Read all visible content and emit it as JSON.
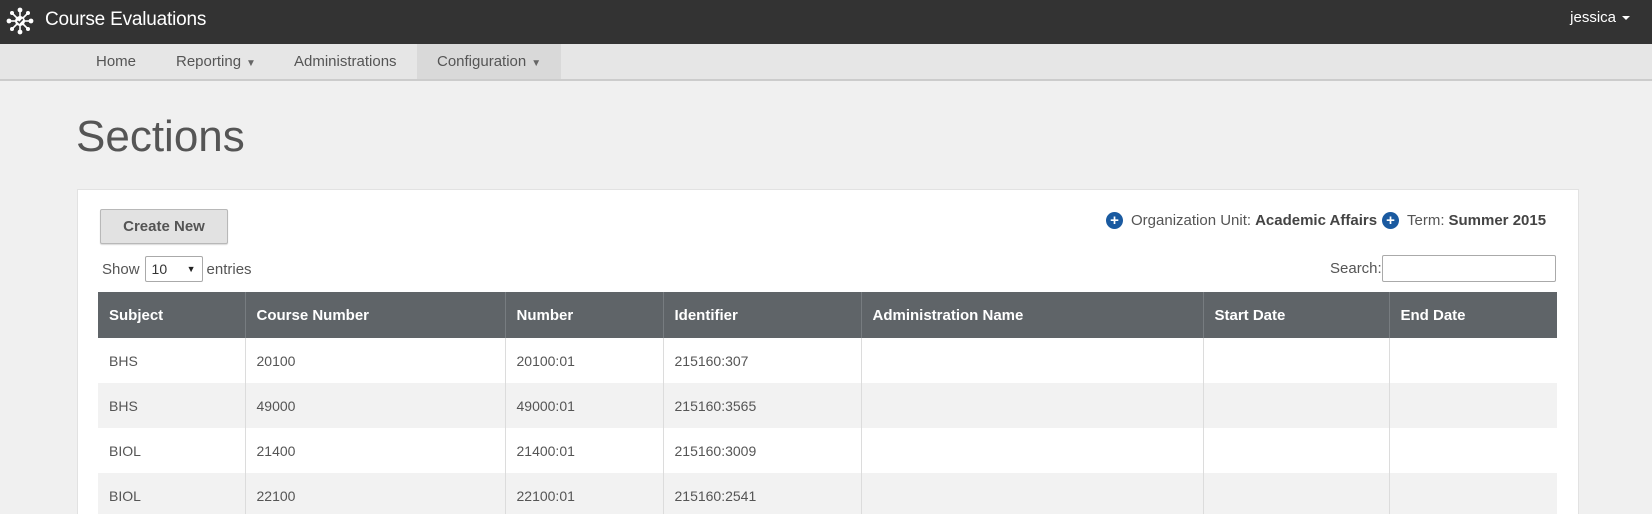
{
  "app": {
    "title": "Course Evaluations",
    "user": "jessica"
  },
  "nav": [
    {
      "label": "Home",
      "dropdown": false
    },
    {
      "label": "Reporting",
      "dropdown": true
    },
    {
      "label": "Administrations",
      "dropdown": false
    },
    {
      "label": "Configuration",
      "dropdown": true,
      "active": true
    }
  ],
  "page": {
    "title": "Sections"
  },
  "toolbar": {
    "create_label": "Create New"
  },
  "filters": {
    "org_label": "Organization Unit:",
    "org_value": "Academic Affairs",
    "term_label": "Term:",
    "term_value": "Summer 2015"
  },
  "entries": {
    "show_label": "Show",
    "value": "10",
    "suffix": "entries"
  },
  "search": {
    "label": "Search:",
    "value": ""
  },
  "table": {
    "headers": [
      "Subject",
      "Course Number",
      "Number",
      "Identifier",
      "Administration Name",
      "Start Date",
      "End Date"
    ],
    "rows": [
      [
        "BHS",
        "20100",
        "20100:01",
        "215160:307",
        "",
        "",
        ""
      ],
      [
        "BHS",
        "49000",
        "49000:01",
        "215160:3565",
        "",
        "",
        ""
      ],
      [
        "BIOL",
        "21400",
        "21400:01",
        "215160:3009",
        "",
        "",
        ""
      ],
      [
        "BIOL",
        "22100",
        "22100:01",
        "215160:2541",
        "",
        "",
        ""
      ]
    ]
  },
  "colors": {
    "topbar": "#333333",
    "table_header": "#5f6468",
    "accent": "#1a5aa0"
  }
}
